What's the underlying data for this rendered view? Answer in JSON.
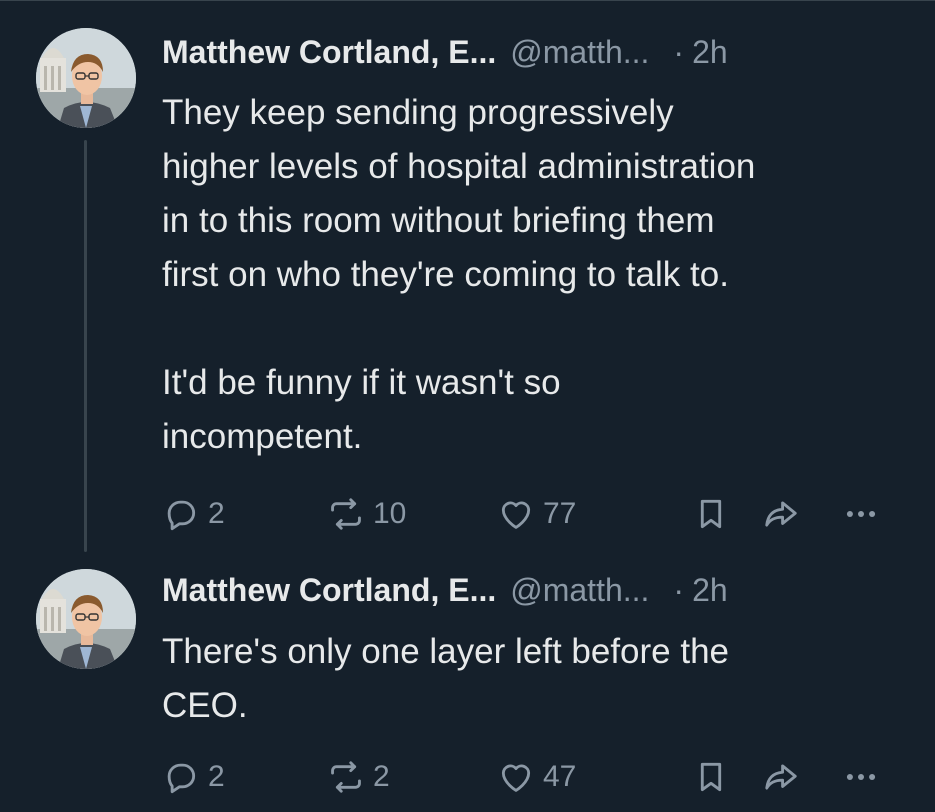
{
  "tweets": [
    {
      "author": {
        "name": "Matthew Cortland, E...",
        "handle": "@matth...",
        "avatar_icon": "profile-photo"
      },
      "separator": "·",
      "time": "2h",
      "text": "They keep sending progressively\nhigher levels of hospital administration\nin to this room without briefing them\nfirst on who they're coming to talk to.\n\nIt'd be funny if it wasn't so\nincompetent.",
      "stats": {
        "replies": "2",
        "retweets": "10",
        "likes": "77"
      }
    },
    {
      "author": {
        "name": "Matthew Cortland, E...",
        "handle": "@matth...",
        "avatar_icon": "profile-photo"
      },
      "separator": "·",
      "time": "2h",
      "text": "There's only one layer left before the\nCEO.",
      "stats": {
        "replies": "2",
        "retweets": "2",
        "likes": "47"
      }
    }
  ],
  "icons": {
    "reply": "reply-icon",
    "retweet": "retweet-icon",
    "like": "heart-icon",
    "bookmark": "bookmark-icon",
    "share": "share-icon",
    "more": "more-icon"
  },
  "colors": {
    "background": "#15202b",
    "primary_text": "#e7e9ea",
    "secondary_text": "#8b98a5",
    "thread_line": "#38444d"
  }
}
